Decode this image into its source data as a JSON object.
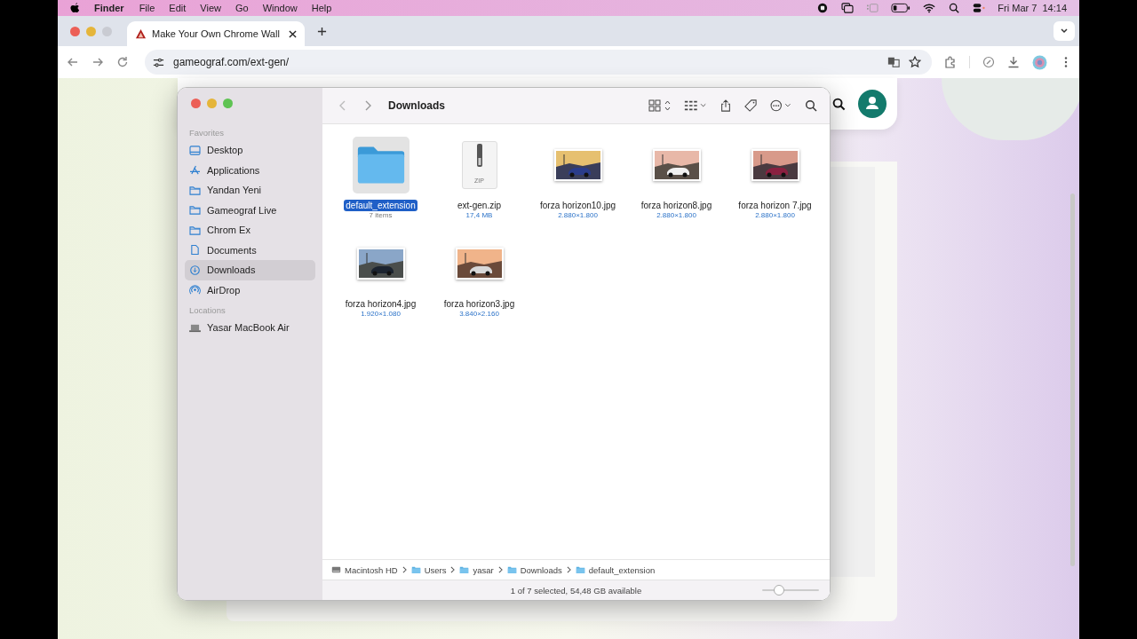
{
  "menu_bar": {
    "app": "Finder",
    "menus": [
      "File",
      "Edit",
      "View",
      "Go",
      "Window",
      "Help"
    ],
    "clock": "Fri Mar 7  14:14"
  },
  "browser": {
    "tabs": [
      {
        "title": "Make Your Own Chrome Wall",
        "selected": true
      }
    ],
    "url": "gameograf.com/ext-gen/"
  },
  "finder": {
    "title": "Downloads",
    "sidebar": [
      {
        "heading": "Favorites",
        "items": [
          {
            "label": "Desktop",
            "kind": "desktop",
            "selected": false
          },
          {
            "label": "Applications",
            "kind": "apps",
            "selected": false
          },
          {
            "label": "Yandan Yeni",
            "kind": "folder",
            "selected": false
          },
          {
            "label": "Gameograf Live",
            "kind": "folder",
            "selected": false
          },
          {
            "label": "Chrom Ex",
            "kind": "folder",
            "selected": false
          },
          {
            "label": "Documents",
            "kind": "document",
            "selected": false
          },
          {
            "label": "Downloads",
            "kind": "download",
            "selected": true
          },
          {
            "label": "AirDrop",
            "kind": "airdrop",
            "selected": false
          }
        ]
      },
      {
        "heading": "Locations",
        "items": [
          {
            "label": "Yasar MacBook Air",
            "kind": "laptop",
            "selected": false
          }
        ]
      }
    ],
    "files": [
      {
        "name": "default_extension",
        "detail": "7 items",
        "kind": "folder",
        "selected": true
      },
      {
        "name": "ext-gen.zip",
        "detail": "17,4 MB",
        "kind": "zip",
        "badge": "ZIP",
        "selected": false
      },
      {
        "name": "forza horizon10.jpg",
        "detail": "2.880×1.800",
        "selected": false
      },
      {
        "name": "forza horizon8.jpg",
        "detail": "2.880×1.800",
        "selected": false
      },
      {
        "name": "forza horizon 7.jpg",
        "detail": "2.880×1.800",
        "selected": false
      },
      {
        "name": "forza horizon4.jpg",
        "detail": "1.920×1.080",
        "selected": false
      },
      {
        "name": "forza horizon3.jpg",
        "detail": "3.840×2.160",
        "selected": false
      }
    ],
    "path": [
      {
        "label": "Macintosh HD",
        "kind": "disk"
      },
      {
        "label": "Users",
        "kind": "folder"
      },
      {
        "label": "yasar",
        "kind": "folder"
      },
      {
        "label": "Downloads",
        "kind": "folder"
      },
      {
        "label": "default_extension",
        "kind": "folder"
      }
    ],
    "status": "1 of 7 selected, 54,48 GB available",
    "icon_size": {
      "level": 0.3
    }
  }
}
